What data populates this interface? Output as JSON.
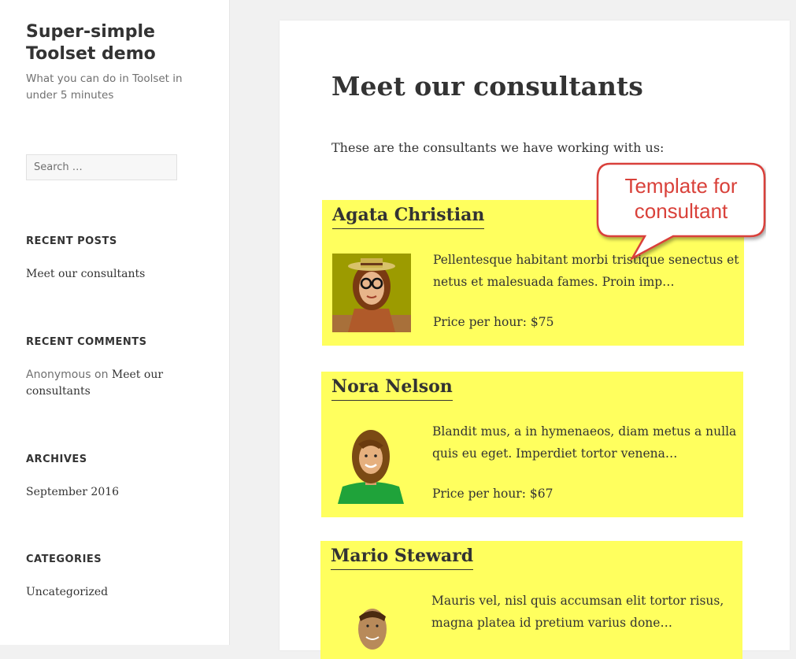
{
  "site": {
    "title": "Super-simple Toolset demo",
    "description": "What you can do in Toolset in under 5 minutes"
  },
  "search": {
    "placeholder": "Search …"
  },
  "widgets": {
    "recent_posts": {
      "title": "RECENT POSTS",
      "items": [
        "Meet our consultants"
      ]
    },
    "recent_comments": {
      "title": "RECENT COMMENTS",
      "author": "Anonymous",
      "connector": "on",
      "post": "Meet our consultants"
    },
    "archives": {
      "title": "ARCHIVES",
      "items": [
        "September 2016"
      ]
    },
    "categories": {
      "title": "CATEGORIES",
      "items": [
        "Uncategorized"
      ]
    }
  },
  "page": {
    "title": "Meet our consultants",
    "intro": "These are the consultants we have working with us:"
  },
  "consultants": [
    {
      "name": "Agata Christian",
      "excerpt": "Pellentesque habitant morbi tristique senectus et netus et malesuada fames. Proin imp…",
      "price": "Price per hour: $75"
    },
    {
      "name": "Nora Nelson",
      "excerpt": "Blandit mus, a in hymenaeos, diam metus a nulla quis eu eget. Imperdiet tortor venena…",
      "price": "Price per hour: $67"
    },
    {
      "name": "Mario Steward",
      "excerpt": "Mauris vel, nisl quis accumsan elit tortor risus, magna platea id pretium varius done…",
      "price": ""
    }
  ],
  "callout": {
    "text": "Template for consultant"
  },
  "colors": {
    "highlight": "#ffff5e",
    "callout_border": "#d9413a",
    "callout_text": "#d9413a"
  }
}
